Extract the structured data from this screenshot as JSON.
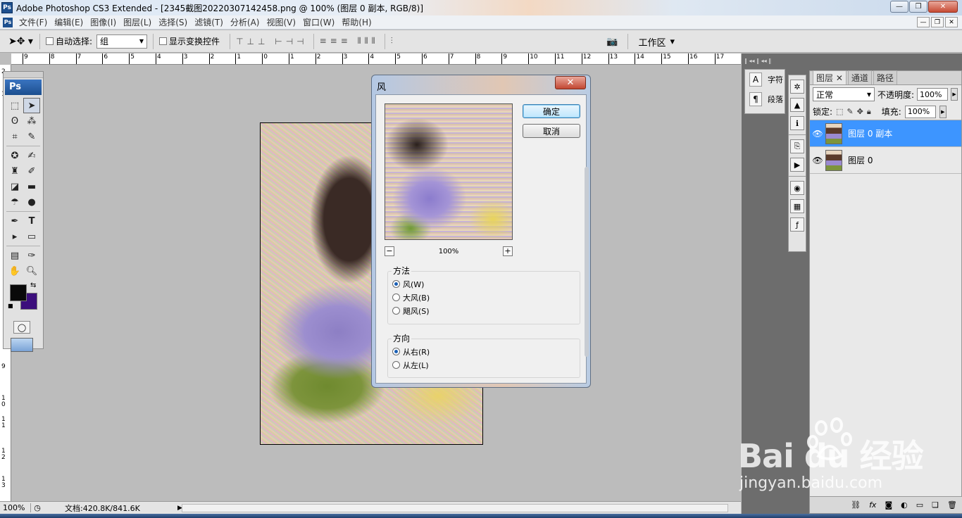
{
  "window": {
    "app_badge": "Ps",
    "title": "Adobe Photoshop CS3 Extended - [2345截图20220307142458.png @ 100% (图层 0 副本, RGB/8)]",
    "controls": [
      "—",
      "❐",
      "✕"
    ]
  },
  "menubar": {
    "items": [
      "文件(F)",
      "编辑(E)",
      "图像(I)",
      "图层(L)",
      "选择(S)",
      "滤镜(T)",
      "分析(A)",
      "视图(V)",
      "窗口(W)",
      "帮助(H)"
    ]
  },
  "options": {
    "auto_select_label": "自动选择:",
    "auto_select_value": "组",
    "show_transform_label": "显示变换控件",
    "workspace_label": "工作区"
  },
  "ruler": {
    "top_ticks": [
      "9",
      "8",
      "7",
      "6",
      "5",
      "4",
      "3",
      "2",
      "1",
      "0",
      "1",
      "2",
      "3",
      "4",
      "5",
      "6",
      "7",
      "8",
      "9",
      "10",
      "11",
      "12",
      "13",
      "14",
      "15",
      "16",
      "17"
    ],
    "left_ticks": [
      "2",
      "1",
      "9",
      "1 0",
      "1 1",
      "1 2",
      "1 3"
    ]
  },
  "toolbox": {
    "logo": "Ps"
  },
  "statusbar": {
    "zoom": "100%",
    "doc": "文档:420.8K/841.6K"
  },
  "dialog": {
    "title": "风",
    "ok_label": "确定",
    "cancel_label": "取消",
    "zoom": "100%",
    "method_title": "方法",
    "methods": [
      {
        "label": "风(W)",
        "selected": true
      },
      {
        "label": "大风(B)",
        "selected": false
      },
      {
        "label": "飓风(S)",
        "selected": false
      }
    ],
    "direction_title": "方向",
    "directions": [
      {
        "label": "从右(R)",
        "selected": true
      },
      {
        "label": "从左(L)",
        "selected": false
      }
    ]
  },
  "dock": {
    "character_label": "字符",
    "paragraph_label": "段落"
  },
  "layers_panel": {
    "tabs": [
      "图层",
      "通道",
      "路径"
    ],
    "blend_mode": "正常",
    "opacity_label": "不透明度:",
    "opacity_value": "100%",
    "lock_label": "锁定:",
    "fill_label": "填充:",
    "fill_value": "100%",
    "layers": [
      {
        "name": "图层 0 副本",
        "selected": true
      },
      {
        "name": "图层 0",
        "selected": false
      }
    ]
  },
  "watermark": {
    "brand": "Bai  du 经验",
    "url": "jingyan.baidu.com"
  },
  "colors": {
    "foreground": "#0a0a0a",
    "background": "#3c0f7c",
    "selection": "#3d95ff"
  }
}
